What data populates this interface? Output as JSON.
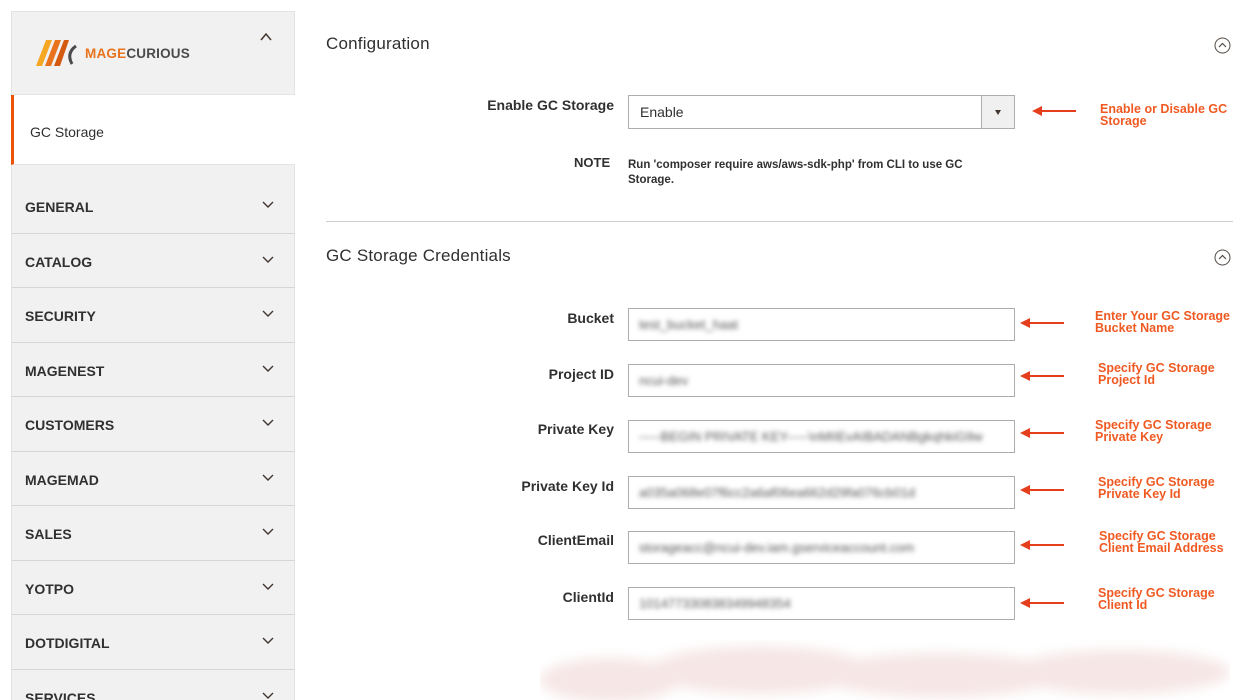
{
  "brand": {
    "logo_prefix": "MAGE",
    "logo_suffix": "CURIOUS",
    "accent_color": "#eb5202",
    "annotation_color": "#f05a22"
  },
  "sidebar": {
    "collapse_icon": "chevron-up-icon",
    "active_item": "GC Storage",
    "items": [
      {
        "label": "GENERAL"
      },
      {
        "label": "CATALOG"
      },
      {
        "label": "SECURITY"
      },
      {
        "label": "MAGENEST"
      },
      {
        "label": "CUSTOMERS"
      },
      {
        "label": "MAGEMAD"
      },
      {
        "label": "SALES"
      },
      {
        "label": "YOTPO"
      },
      {
        "label": "DOTDIGITAL"
      },
      {
        "label": "SERVICES"
      }
    ]
  },
  "configuration": {
    "title": "Configuration",
    "toggle_icon": "collapse-circle-icon",
    "enable_label": "Enable GC Storage",
    "enable_value": "Enable",
    "enable_annotation": "Enable or Disable GC Storage",
    "note_label": "NOTE",
    "note_text": "Run 'composer require aws/aws-sdk-php' from CLI to use GC Storage."
  },
  "credentials": {
    "title": "GC Storage Credentials",
    "toggle_icon": "collapse-circle-icon",
    "fields": [
      {
        "label": "Bucket",
        "value": "test_bucket_haat",
        "annotation": "Enter Your GC Storage Bucket Name"
      },
      {
        "label": "Project ID",
        "value": "ncui-dev",
        "annotation": "Specify GC Storage Project Id"
      },
      {
        "label": "Private Key",
        "value": "-----BEGIN PRIVATE KEY-----\\nMIIEvAIBADANBgkqhkiG9w",
        "annotation": "Specify GC Storage Private Key"
      },
      {
        "label": "Private Key Id",
        "value": "a035a068e07f6cc2a6af06ea662d29fa076cb01d",
        "annotation": "Specify GC Storage Private Key Id"
      },
      {
        "label": "ClientEmail",
        "value": "storageacc@ncui-dev.iam.gserviceaccount.com",
        "annotation": "Specify GC Storage Client Email Address"
      },
      {
        "label": "ClientId",
        "value": "101477330838349948354",
        "annotation": "Specify GC Storage Client Id"
      }
    ]
  }
}
